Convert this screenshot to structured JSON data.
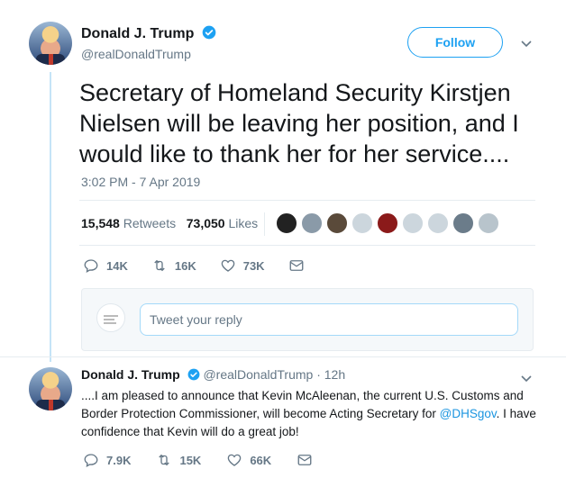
{
  "main_tweet": {
    "author_name": "Donald J. Trump",
    "author_handle": "@realDonaldTrump",
    "follow_label": "Follow",
    "text": "Secretary of Homeland Security Kirstjen Nielsen will be leaving her position, and I would like to thank her for her service....",
    "timestamp": "3:02 PM - 7 Apr 2019",
    "retweets_count": "15,548",
    "retweets_label": "Retweets",
    "likes_count": "73,050",
    "likes_label": "Likes",
    "reply_count": "14K",
    "retweet_count_short": "16K",
    "like_count_short": "73K"
  },
  "reply_box": {
    "placeholder": "Tweet your reply"
  },
  "reply_tweet": {
    "author_name": "Donald J. Trump",
    "author_handle": "@realDonaldTrump",
    "time": "· 12h",
    "text_before": "....I am pleased to announce that Kevin McAleenan, the current U.S. Customs and Border Protection Commissioner, will become Acting Secretary for ",
    "mention": "@DHSgov",
    "text_after": ". I have confidence that Kevin will do a great job!",
    "reply_count": "7.9K",
    "retweet_count": "15K",
    "like_count": "66K"
  },
  "colors": {
    "accent": "#1da1f2",
    "muted": "#657786",
    "thread_line": "#c5e4f7"
  }
}
